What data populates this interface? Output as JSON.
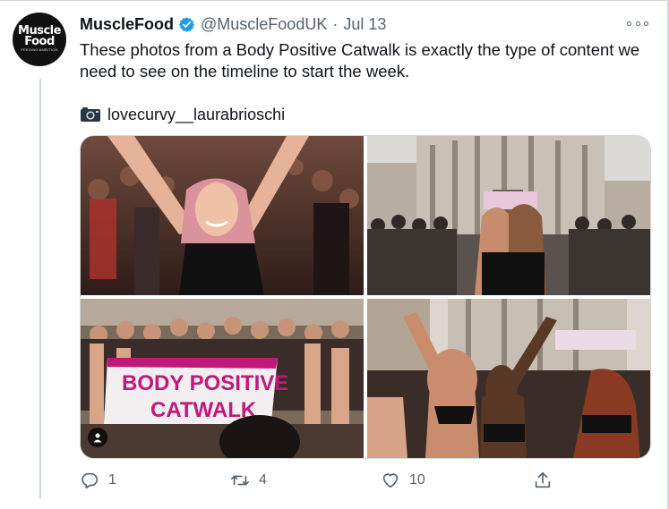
{
  "tweet": {
    "author_name": "MuscleFood",
    "handle": "@MuscleFoodUK",
    "separator": "·",
    "date": "Jul 13",
    "avatar_line1": "Muscle",
    "avatar_line2": "Food",
    "avatar_line3": "FEEDING AMBITION",
    "text": "These photos from a Body Positive Catwalk is exactly the type of content we need to see on the timeline to start the week.",
    "photo_credit": "lovecurvy__laurabrioschi",
    "banner_line1": "BODY POSITIVE",
    "banner_line2": "CATWALK",
    "stats": {
      "replies": "1",
      "retweets": "4",
      "likes": "10"
    }
  },
  "colors": {
    "text_primary": "#0f1419",
    "text_secondary": "#536471",
    "verified": "#1d9bf0",
    "border": "#cfd9de",
    "banner_pink": "#c2187a"
  },
  "icons": {
    "verified": "verified-badge-icon",
    "more": "more-options-icon",
    "camera": "camera-icon",
    "reply": "reply-icon",
    "retweet": "retweet-icon",
    "like": "heart-icon",
    "share": "share-icon",
    "tag": "person-tag-icon"
  }
}
